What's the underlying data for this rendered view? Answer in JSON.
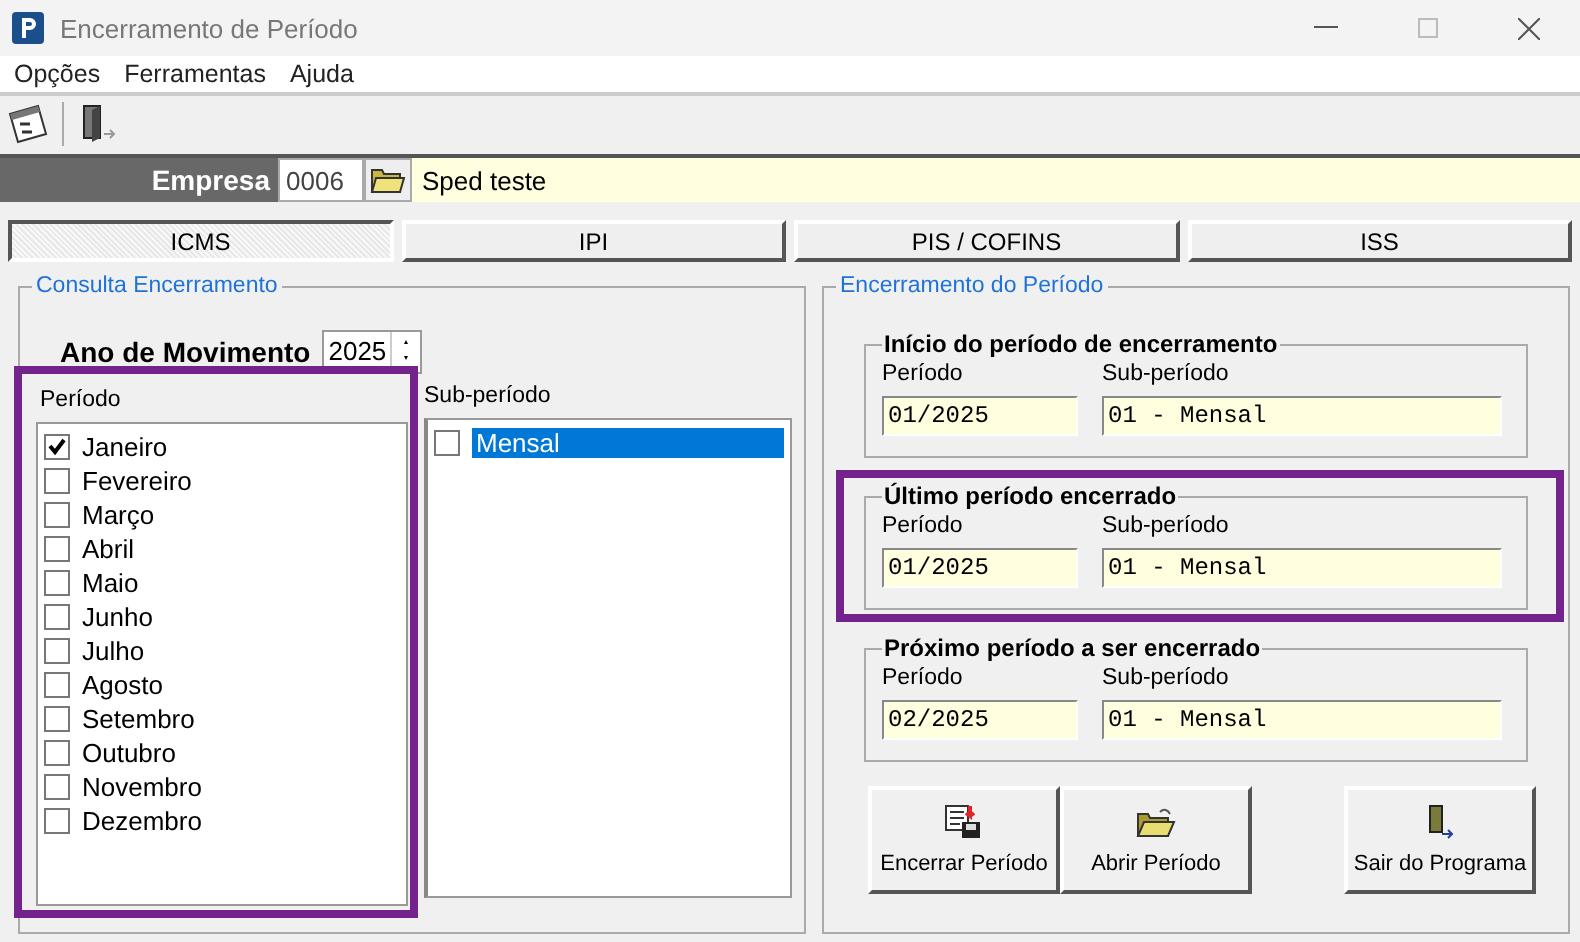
{
  "window": {
    "title": "Encerramento de Período"
  },
  "menu": [
    {
      "label": "Opções"
    },
    {
      "label": "Ferramentas"
    },
    {
      "label": "Ajuda"
    }
  ],
  "empresa": {
    "label": "Empresa",
    "code": "0006",
    "name": "Sped teste"
  },
  "tabs": [
    {
      "label": "ICMS",
      "selected": true
    },
    {
      "label": "IPI",
      "selected": false
    },
    {
      "label": "PIS / COFINS",
      "selected": false
    },
    {
      "label": "ISS",
      "selected": false
    }
  ],
  "consulta": {
    "title": "Consulta Encerramento",
    "ano_label": "Ano de Movimento",
    "ano_value": "2025",
    "periodo_label": "Período",
    "highlighted": true,
    "months": [
      {
        "label": "Janeiro",
        "checked": true
      },
      {
        "label": "Fevereiro",
        "checked": false
      },
      {
        "label": "Março",
        "checked": false
      },
      {
        "label": "Abril",
        "checked": false
      },
      {
        "label": "Maio",
        "checked": false
      },
      {
        "label": "Junho",
        "checked": false
      },
      {
        "label": "Julho",
        "checked": false
      },
      {
        "label": "Agosto",
        "checked": false
      },
      {
        "label": "Setembro",
        "checked": false
      },
      {
        "label": "Outubro",
        "checked": false
      },
      {
        "label": "Novembro",
        "checked": false
      },
      {
        "label": "Dezembro",
        "checked": false
      }
    ],
    "subperiodo_label": "Sub-período",
    "subperiodos": [
      {
        "label": "Mensal",
        "checked": false,
        "selected": true
      }
    ]
  },
  "encerramento": {
    "title": "Encerramento do Período",
    "groups": [
      {
        "title": "Início do período de encerramento",
        "periodo_label": "Período",
        "periodo_value": "01/2025",
        "subperiodo_label": "Sub-período",
        "subperiodo_value": "01 - Mensal",
        "highlighted": false
      },
      {
        "title": "Último período encerrado",
        "periodo_label": "Período",
        "periodo_value": "01/2025",
        "subperiodo_label": "Sub-período",
        "subperiodo_value": "01 - Mensal",
        "highlighted": true
      },
      {
        "title": "Próximo período a ser encerrado",
        "periodo_label": "Período",
        "periodo_value": "02/2025",
        "subperiodo_label": "Sub-período",
        "subperiodo_value": "01 - Mensal",
        "highlighted": false
      }
    ],
    "buttons": [
      {
        "label": "Encerrar Período",
        "kind": "close"
      },
      {
        "label": "Abrir Período",
        "kind": "open"
      },
      {
        "label": "Sair do Programa",
        "kind": "exit"
      }
    ]
  }
}
